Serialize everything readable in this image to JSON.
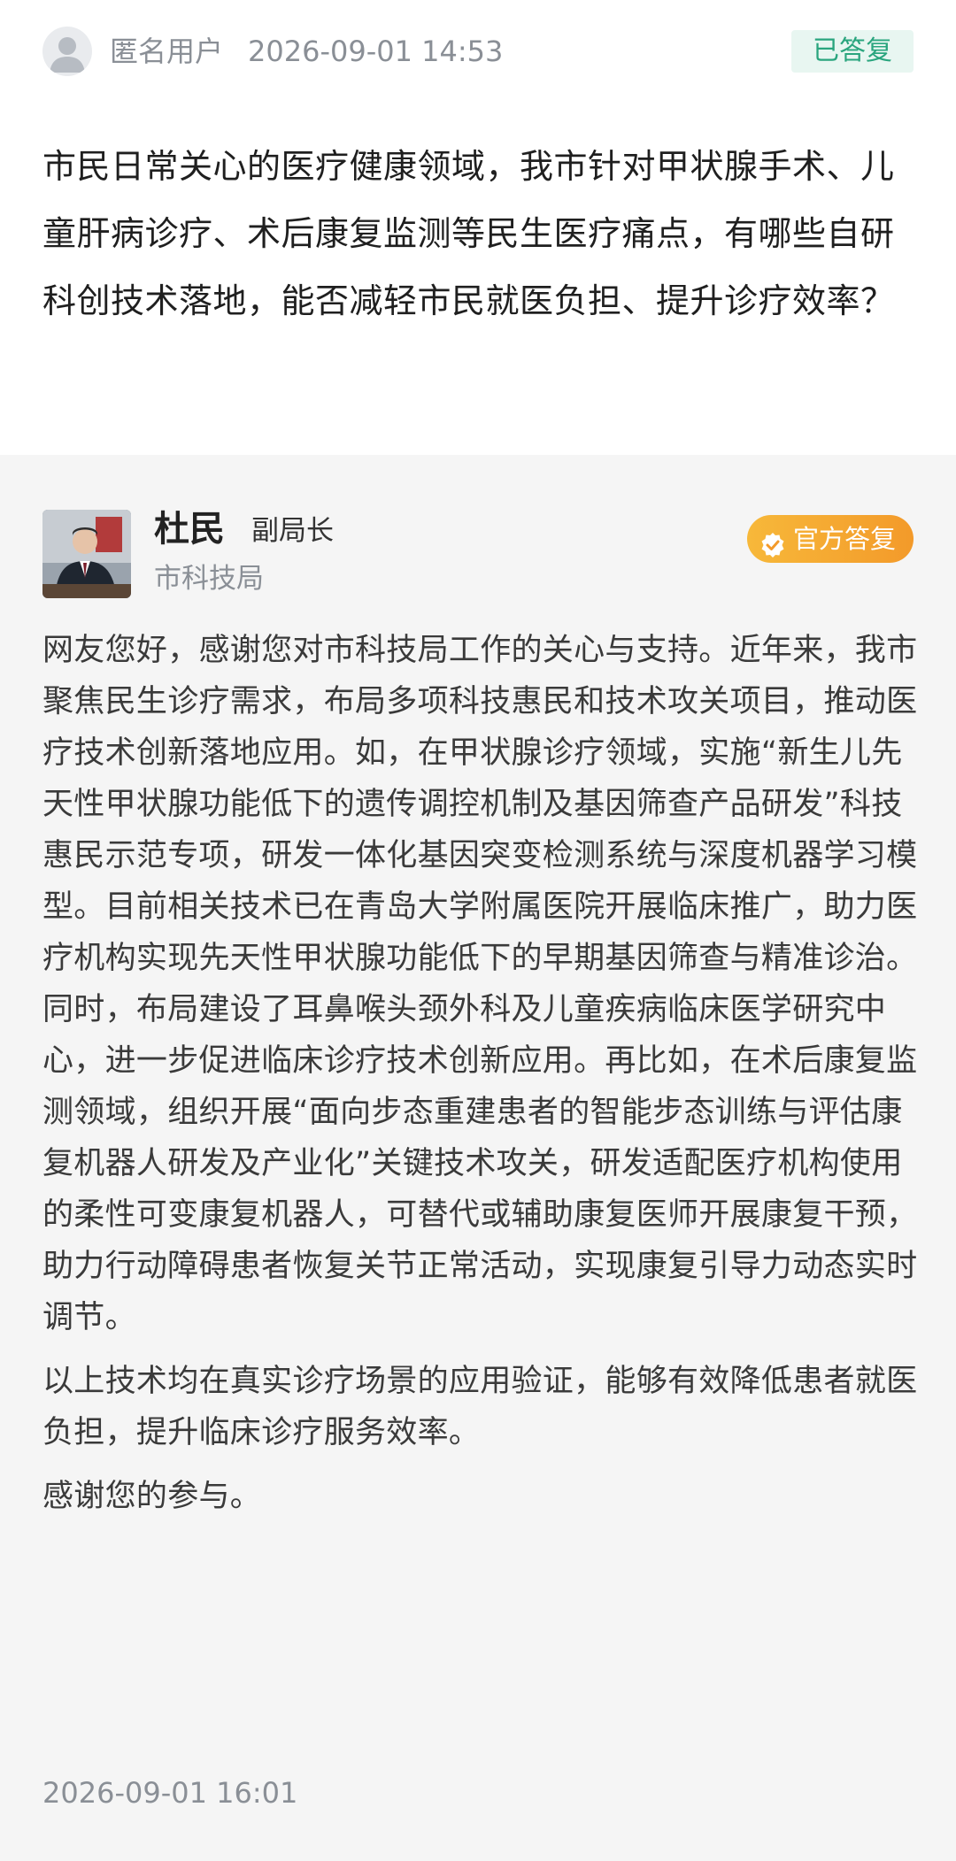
{
  "question": {
    "user_name": "匿名用户",
    "time": "2026-09-01 14:53",
    "status": "已答复",
    "text": "市民日常关心的医疗健康领域，我市针对甲状腺手术、儿童肝病诊疗、术后康复监测等民生医疗痛点，有哪些自研科创技术落地，能否减轻市民就医负担、提升诊疗效率？"
  },
  "answer": {
    "official_name": "杜民",
    "official_title": "副局长",
    "department": "市科技局",
    "badge_label": "官方答复",
    "paragraphs": [
      "网友您好，感谢您对市科技局工作的关心与支持。近年来，我市聚焦民生诊疗需求，布局多项科技惠民和技术攻关项目，推动医疗技术创新落地应用。如，在甲状腺诊疗领域，实施“新生儿先天性甲状腺功能低下的遗传调控机制及基因筛查产品研发”科技惠民示范专项，研发一体化基因突变检测系统与深度机器学习模型。目前相关技术已在青岛大学附属医院开展临床推广，助力医疗机构实现先天性甲状腺功能低下的早期基因筛查与精准诊治。同时，布局建设了耳鼻喉头颈外科及儿童疾病临床医学研究中心，进一步促进临床诊疗技术创新应用。再比如，在术后康复监测领域，组织开展“面向步态重建患者的智能步态训练与评估康复机器人研发及产业化”关键技术攻关，研发适配医疗机构使用的柔性可变康复机器人，可替代或辅助康复医师开展康复干预，助力行动障碍患者恢复关节正常活动，实现康复引导力动态实时调节。",
      "以上技术均在真实诊疗场景的应用验证，能够有效降低患者就医负担，提升临床诊疗服务效率。",
      "感谢您的参与。"
    ],
    "time": "2026-09-01 16:01"
  },
  "colors": {
    "status_green": "#2aa57e",
    "badge_orange": "#f39a2a",
    "answer_bg": "#f5f5f5"
  },
  "icons": {
    "anon_avatar": "user-silhouette-icon",
    "badge": "verified-check-icon"
  }
}
